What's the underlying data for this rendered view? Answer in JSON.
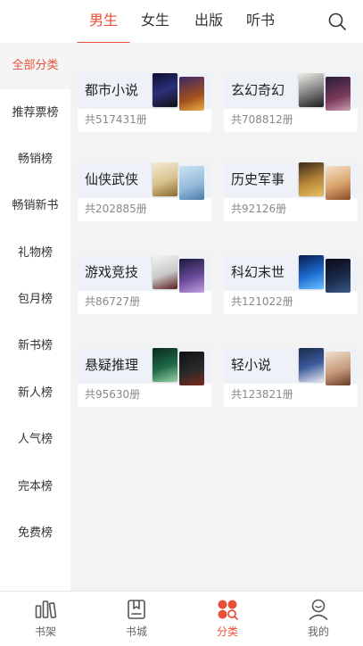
{
  "colors": {
    "accent": "#e8503a",
    "panel_bg": "#f3f3f3",
    "card_head_bg": "#eef2f8"
  },
  "top_tabs": [
    {
      "label": "男生",
      "active": true
    },
    {
      "label": "女生",
      "active": false
    },
    {
      "label": "出版",
      "active": false
    },
    {
      "label": "听书",
      "active": false
    }
  ],
  "search": {
    "icon": "search-icon"
  },
  "sidebar": {
    "items": [
      {
        "label": "全部分类",
        "active": true
      },
      {
        "label": "推荐票榜"
      },
      {
        "label": "畅销榜"
      },
      {
        "label": "畅销新书"
      },
      {
        "label": "礼物榜"
      },
      {
        "label": "包月榜"
      },
      {
        "label": "新书榜"
      },
      {
        "label": "新人榜"
      },
      {
        "label": "人气榜"
      },
      {
        "label": "完本榜"
      },
      {
        "label": "免费榜"
      }
    ]
  },
  "categories": [
    {
      "name": "都市小说",
      "count": "共517431册"
    },
    {
      "name": "玄幻奇幻",
      "count": "共708812册"
    },
    {
      "name": "仙侠武侠",
      "count": "共202885册"
    },
    {
      "name": "历史军事",
      "count": "共92126册"
    },
    {
      "name": "游戏竞技",
      "count": "共86727册"
    },
    {
      "name": "科幻末世",
      "count": "共121022册"
    },
    {
      "name": "悬疑推理",
      "count": "共95630册"
    },
    {
      "name": "轻小说",
      "count": "共123821册"
    }
  ],
  "bottom_nav": [
    {
      "label": "书架",
      "icon": "bookshelf-icon"
    },
    {
      "label": "书城",
      "icon": "bookstore-icon"
    },
    {
      "label": "分类",
      "icon": "category-icon",
      "active": true
    },
    {
      "label": "我的",
      "icon": "profile-icon"
    }
  ]
}
